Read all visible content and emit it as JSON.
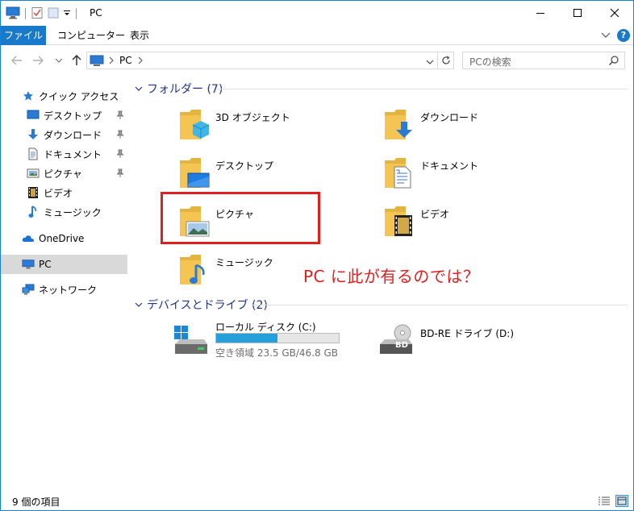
{
  "window": {
    "title": "PC"
  },
  "ribbon": {
    "tabs": [
      "ファイル",
      "コンピューター",
      "表示"
    ]
  },
  "address": {
    "crumb": "PC"
  },
  "search": {
    "placeholder": "PCの検索"
  },
  "nav": {
    "quick_access": "クイック アクセス",
    "quick_items": [
      "デスクトップ",
      "ダウンロード",
      "ドキュメント",
      "ピクチャ",
      "ビデオ",
      "ミュージック"
    ],
    "onedrive": "OneDrive",
    "pc": "PC",
    "network": "ネットワーク"
  },
  "folders": {
    "header": "フォルダー (7)",
    "items": [
      "3D オブジェクト",
      "ダウンロード",
      "デスクトップ",
      "ドキュメント",
      "ピクチャ",
      "ビデオ",
      "ミュージック"
    ]
  },
  "drives": {
    "header": "デバイスとドライブ (2)",
    "c": {
      "name": "ローカル ディスク (C:)",
      "free": "空き領域 23.5 GB/46.8 GB",
      "used_fraction": 0.498
    },
    "d": {
      "name": "BD-RE ドライブ (D:)",
      "badge": "BD"
    }
  },
  "annotation": "PC に此が有るのでは？",
  "status": {
    "count": "9 個の項目"
  },
  "colors": {
    "accent": "#1979ca",
    "highlight": "#e02020",
    "folder": "#f4c552",
    "drive_fill": "#26a0da"
  }
}
